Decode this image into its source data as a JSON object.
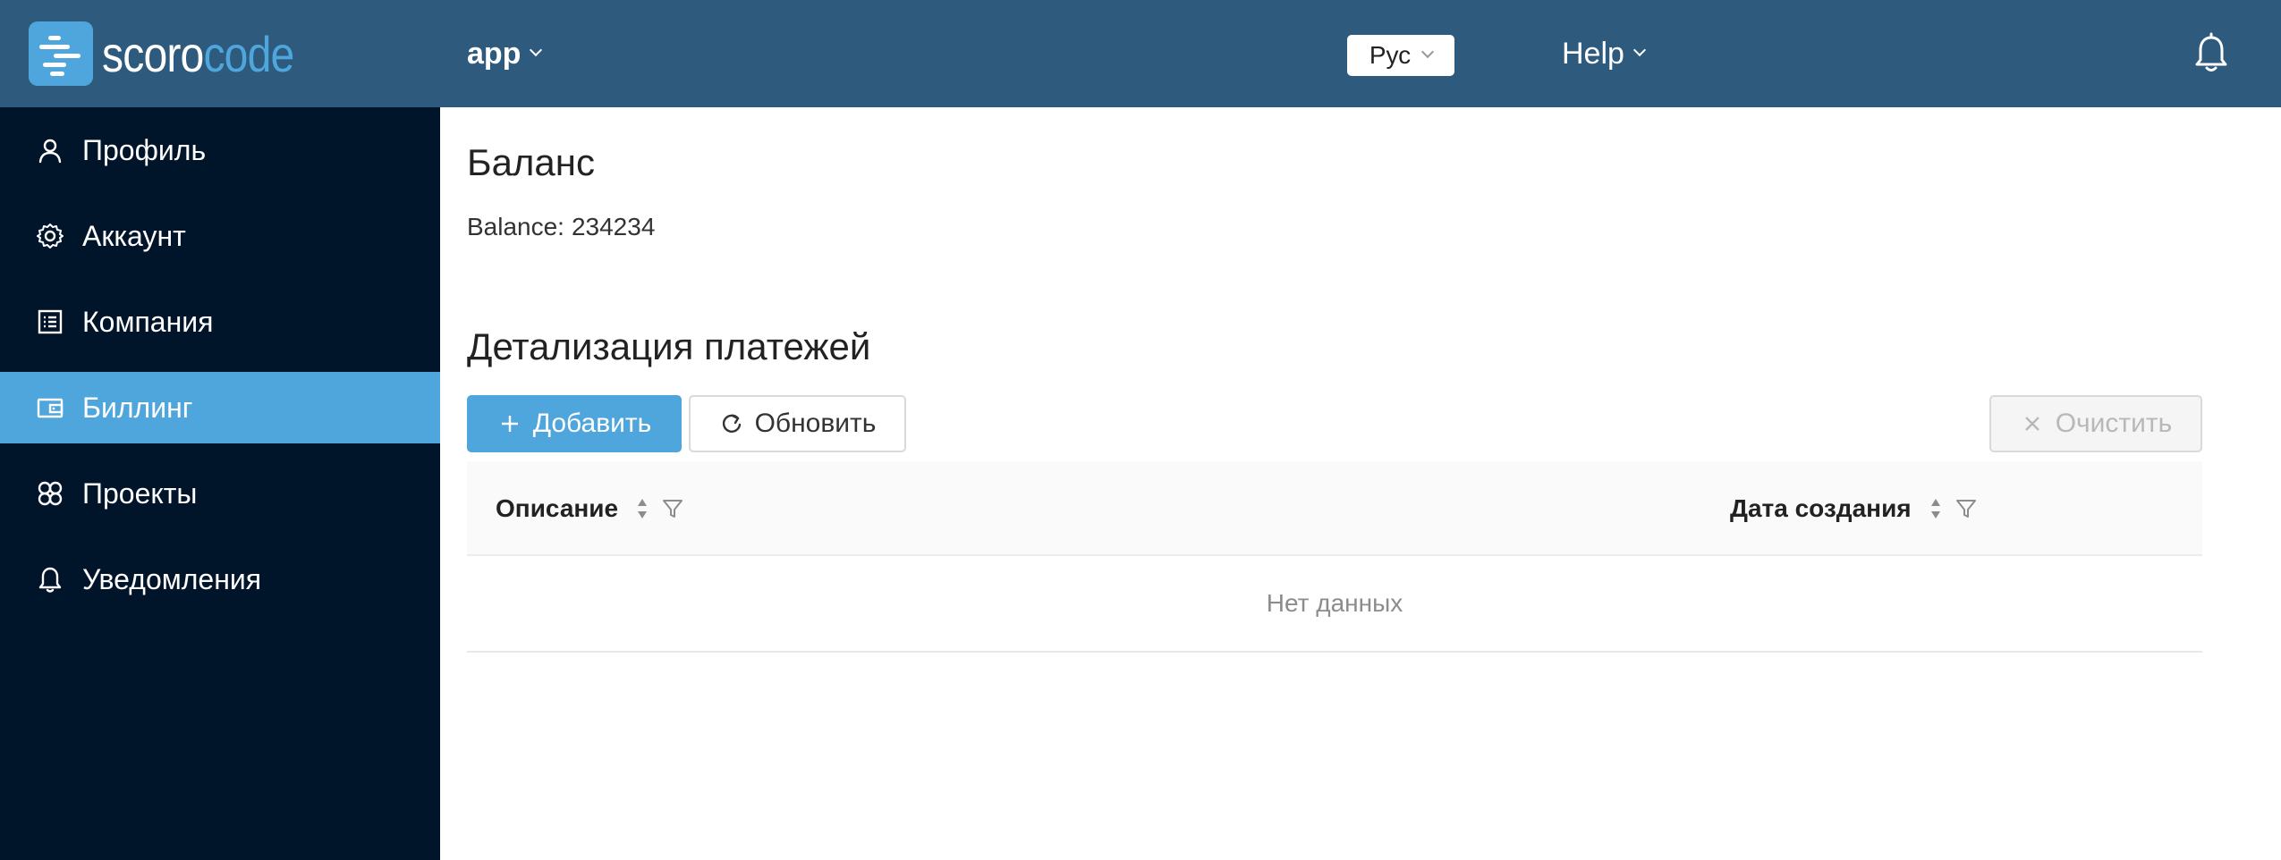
{
  "header": {
    "logo": {
      "text_main": "scoro",
      "text_accent": "code"
    },
    "app_select": {
      "label": "app"
    },
    "lang_select": {
      "value": "Рус"
    },
    "help": {
      "label": "Help"
    },
    "notifications_icon": "bell-icon",
    "colors": {
      "background": "#2d5a7d",
      "accent": "#4fa6dc"
    }
  },
  "sidebar": {
    "colors": {
      "background": "#00142a",
      "active": "#4fa6dc"
    },
    "items": [
      {
        "label": "Профиль",
        "icon": "user-icon",
        "active": false
      },
      {
        "label": "Аккаунт",
        "icon": "gear-icon",
        "active": false
      },
      {
        "label": "Компания",
        "icon": "list-icon",
        "active": false
      },
      {
        "label": "Биллинг",
        "icon": "wallet-icon",
        "active": true
      },
      {
        "label": "Проекты",
        "icon": "projects-icon",
        "active": false
      },
      {
        "label": "Уведомления",
        "icon": "bell-icon",
        "active": false
      }
    ]
  },
  "main": {
    "balance_title": "Баланс",
    "balance_label": "Balance:",
    "balance_value": "234234",
    "payments_title": "Детализация платежей",
    "toolbar": {
      "add_label": "Добавить",
      "refresh_label": "Обновить",
      "clear_label": "Очистить"
    },
    "table": {
      "columns": [
        {
          "label": "Описание"
        },
        {
          "label": "Дата создания"
        }
      ],
      "empty_text": "Нет данных"
    }
  }
}
